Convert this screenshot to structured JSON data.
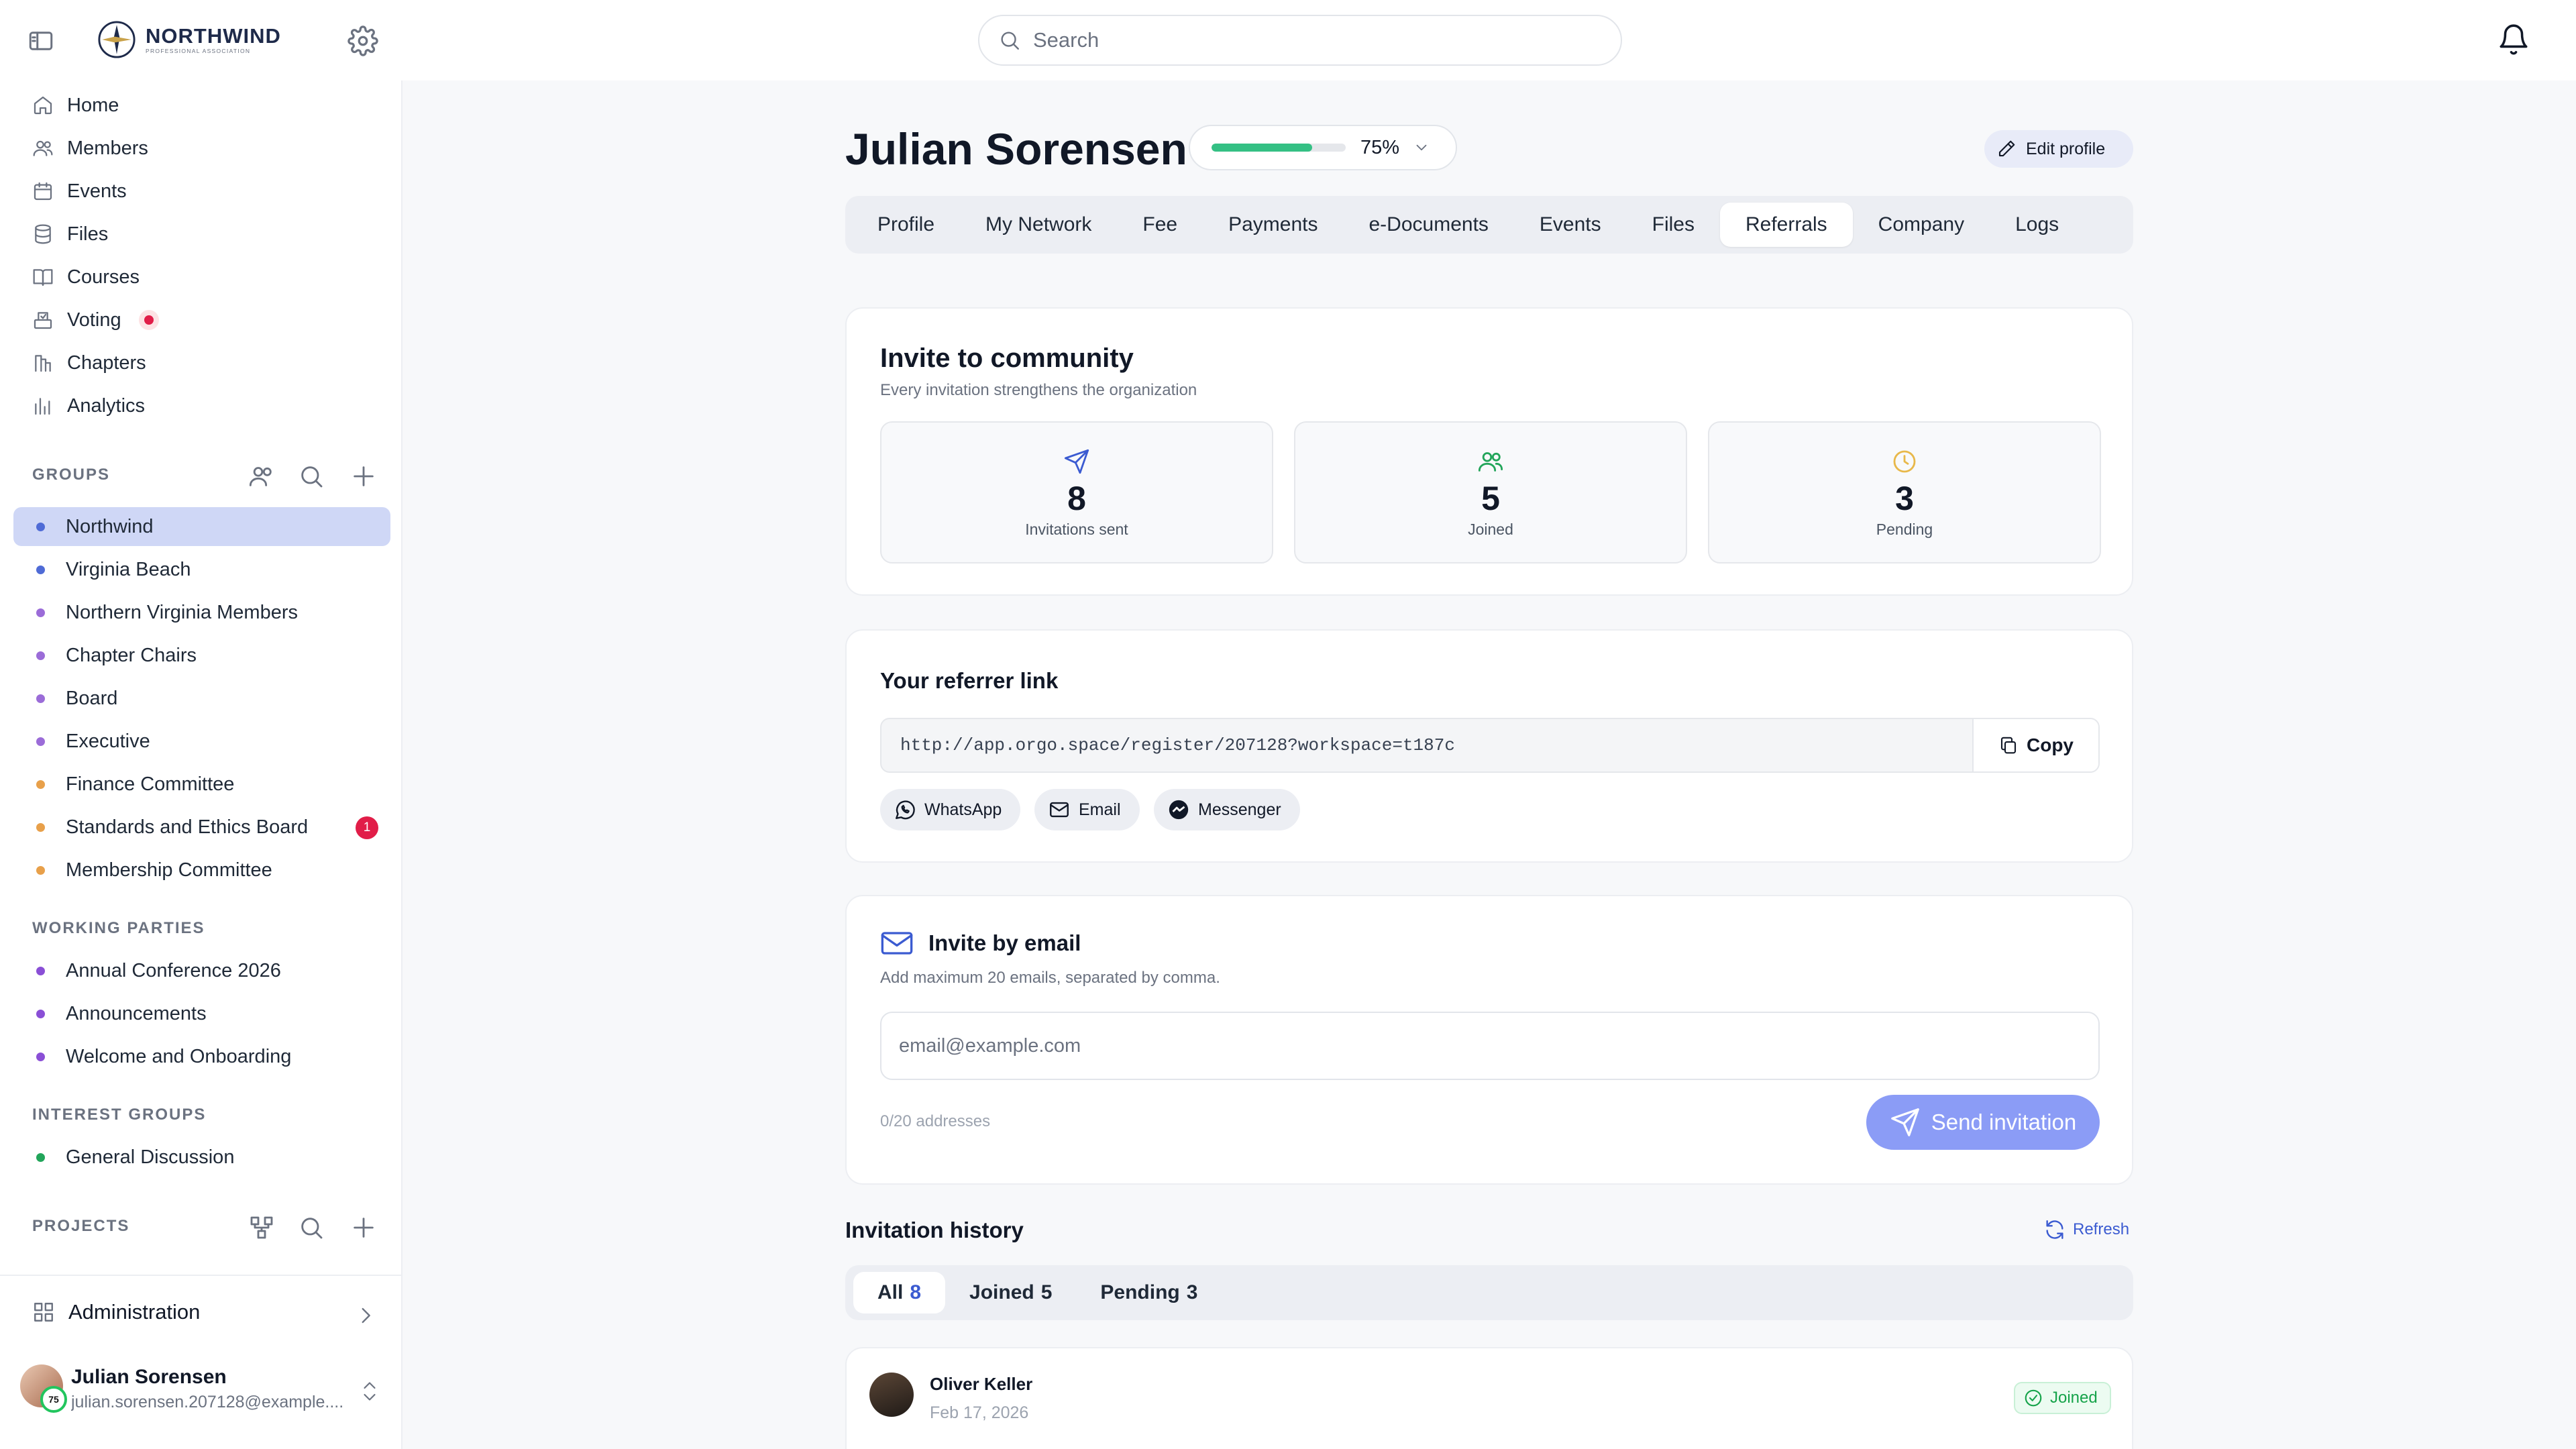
{
  "app": {
    "brand": "NORTHWIND",
    "brand_sub": "PROFESSIONAL ASSOCIATION"
  },
  "search": {
    "placeholder": "Search"
  },
  "nav": [
    {
      "label": "Home",
      "icon": "home-icon"
    },
    {
      "label": "Members",
      "icon": "members-icon"
    },
    {
      "label": "Events",
      "icon": "calendar-icon"
    },
    {
      "label": "Files",
      "icon": "files-icon"
    },
    {
      "label": "Courses",
      "icon": "book-icon"
    },
    {
      "label": "Voting",
      "icon": "ballot-icon"
    },
    {
      "label": "Chapters",
      "icon": "chapters-icon"
    },
    {
      "label": "Analytics",
      "icon": "analytics-icon"
    }
  ],
  "sections": {
    "groups": "GROUPS",
    "working": "WORKING PARTIES",
    "interest": "INTEREST GROUPS",
    "projects": "PROJECTS"
  },
  "groups": [
    {
      "label": "Northwind",
      "color": "#4f6bd6"
    },
    {
      "label": "Virginia Beach",
      "color": "#4f6bd6"
    },
    {
      "label": "Northern Virginia Members",
      "color": "#9b6cd8"
    },
    {
      "label": "Chapter Chairs",
      "color": "#9b6cd8"
    },
    {
      "label": "Board",
      "color": "#9b6cd8"
    },
    {
      "label": "Executive",
      "color": "#9b6cd8"
    },
    {
      "label": "Finance Committee",
      "color": "#e8a04a"
    },
    {
      "label": "Standards and Ethics Board",
      "color": "#e8a04a",
      "badge": "1"
    },
    {
      "label": "Membership Committee",
      "color": "#e8a04a"
    }
  ],
  "working_parties": [
    {
      "label": "Annual Conference 2026",
      "color": "#8a4fd6"
    },
    {
      "label": "Announcements",
      "color": "#8a4fd6"
    },
    {
      "label": "Welcome and Onboarding",
      "color": "#8a4fd6"
    }
  ],
  "interest_groups": [
    {
      "label": "General Discussion",
      "color": "#22a55a"
    }
  ],
  "sidebar_bottom": {
    "admin": "Administration",
    "user_name": "Julian Sorensen",
    "user_email": "julian.sorensen.207128@example....",
    "user_level": "75"
  },
  "profile": {
    "name": "Julian Sorensen",
    "completion_pct": 75,
    "completion_label": "75%",
    "edit_label": "Edit profile"
  },
  "tabs": [
    "Profile",
    "My Network",
    "Fee",
    "Payments",
    "e-Documents",
    "Events",
    "Files",
    "Referrals",
    "Company",
    "Logs"
  ],
  "active_tab": "Referrals",
  "invite": {
    "title": "Invite to community",
    "subtitle": "Every invitation strengthens the organization",
    "stats": [
      {
        "value": "8",
        "label": "Invitations sent",
        "color": "#3b5bd1",
        "icon": "send-icon"
      },
      {
        "value": "5",
        "label": "Joined",
        "color": "#22a55a",
        "icon": "people-icon"
      },
      {
        "value": "3",
        "label": "Pending",
        "color": "#e8b84a",
        "icon": "clock-icon"
      }
    ]
  },
  "referrer": {
    "title": "Your referrer link",
    "url": "http://app.orgo.space/register/207128?workspace=t187c",
    "copy": "Copy",
    "share": [
      "WhatsApp",
      "Email",
      "Messenger"
    ]
  },
  "email_invite": {
    "title": "Invite by email",
    "hint": "Add maximum 20 emails, separated by comma.",
    "placeholder": "email@example.com",
    "count": "0/20 addresses",
    "send": "Send invitation"
  },
  "history": {
    "title": "Invitation history",
    "refresh": "Refresh",
    "filters": [
      {
        "label": "All",
        "count": "8"
      },
      {
        "label": "Joined",
        "count": "5"
      },
      {
        "label": "Pending",
        "count": "3"
      }
    ],
    "rows": [
      {
        "name": "Oliver Keller",
        "date": "Feb 17, 2026",
        "status": "Joined"
      }
    ]
  },
  "colors": {
    "accent": "#3b5bd1",
    "progress": "#34c084",
    "send_button": "#8b9cf6",
    "badge": "#e11d48"
  }
}
